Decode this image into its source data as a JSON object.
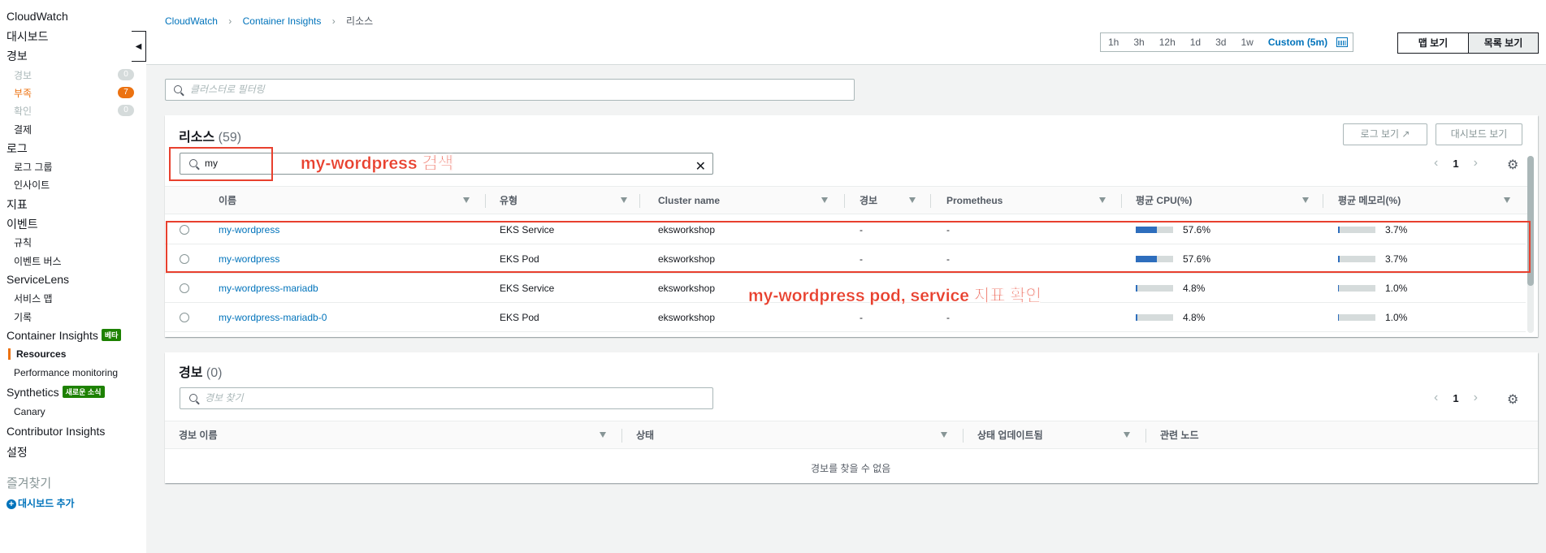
{
  "sidebar": {
    "title": "CloudWatch",
    "dashboards": "대시보드",
    "alarms": "경보",
    "alarm_items": [
      {
        "label": "경보",
        "count": "0"
      },
      {
        "label": "부족",
        "count": "7"
      },
      {
        "label": "확인",
        "count": "0"
      }
    ],
    "billing": "결제",
    "logs": "로그",
    "log_groups": "로그 그룹",
    "insights": "인사이트",
    "metrics": "지표",
    "events": "이벤트",
    "rules": "규칙",
    "event_buses": "이벤트 버스",
    "servicelens": "ServiceLens",
    "service_map": "서비스 맵",
    "records": "기록",
    "container_insights": "Container Insights",
    "beta_badge": "베타",
    "resources": "Resources",
    "performance_monitoring": "Performance monitoring",
    "synthetics": "Synthetics",
    "new_badge": "새로운 소식",
    "canary": "Canary",
    "contributor_insights": "Contributor Insights",
    "settings": "설정",
    "favorites": "즐겨찾기",
    "add_dashboard": "대시보드 추가"
  },
  "breadcrumb": [
    "CloudWatch",
    "Container Insights",
    "리소스"
  ],
  "time_range": {
    "options": [
      "1h",
      "3h",
      "12h",
      "1d",
      "3d",
      "1w",
      "Custom (5m)"
    ],
    "selected": "Custom (5m)"
  },
  "view_toggle": {
    "map": "맵 보기",
    "list": "목록 보기",
    "selected": "목록 보기"
  },
  "cluster_filter_placeholder": "클러스터로 필터링",
  "resources": {
    "title": "리소스",
    "count": "(59)",
    "log_button": "로그 보기",
    "dashboard_button": "대시보드 보기",
    "search_value": "my",
    "page": "1",
    "columns": [
      "이름",
      "유형",
      "Cluster name",
      "경보",
      "Prometheus",
      "평균 CPU(%)",
      "평균 메모리(%)"
    ],
    "rows": [
      {
        "name": "my-wordpress",
        "type": "EKS Service",
        "cluster": "eksworkshop",
        "alarm": "-",
        "prometheus": "-",
        "cpu": 57.6,
        "cpu_label": "57.6%",
        "mem": 3.7,
        "mem_label": "3.7%"
      },
      {
        "name": "my-wordpress",
        "type": "EKS Pod",
        "cluster": "eksworkshop",
        "alarm": "-",
        "prometheus": "-",
        "cpu": 57.6,
        "cpu_label": "57.6%",
        "mem": 3.7,
        "mem_label": "3.7%"
      },
      {
        "name": "my-wordpress-mariadb",
        "type": "EKS Service",
        "cluster": "eksworkshop",
        "alarm": "",
        "prometheus": "",
        "cpu": 4.8,
        "cpu_label": "4.8%",
        "mem": 1.0,
        "mem_label": "1.0%"
      },
      {
        "name": "my-wordpress-mariadb-0",
        "type": "EKS Pod",
        "cluster": "eksworkshop",
        "alarm": "-",
        "prometheus": "-",
        "cpu": 4.8,
        "cpu_label": "4.8%",
        "mem": 1.0,
        "mem_label": "1.0%"
      }
    ]
  },
  "alarms_panel": {
    "title": "경보",
    "count": "(0)",
    "search_placeholder": "경보 찾기",
    "page": "1",
    "columns": [
      "경보 이름",
      "상태",
      "상태 업데이트됨",
      "관련 노드"
    ],
    "empty_message": "경보를 찾을 수 없음"
  },
  "annotations": {
    "search_note": "my-wordpress 검색",
    "metrics_note": "my-wordpress pod, service 지표 확인"
  },
  "colors": {
    "link": "#0073bb",
    "accent_orange": "#ec7211",
    "annotation_red": "#e8402e",
    "bar_fill": "#2e6ebd"
  }
}
